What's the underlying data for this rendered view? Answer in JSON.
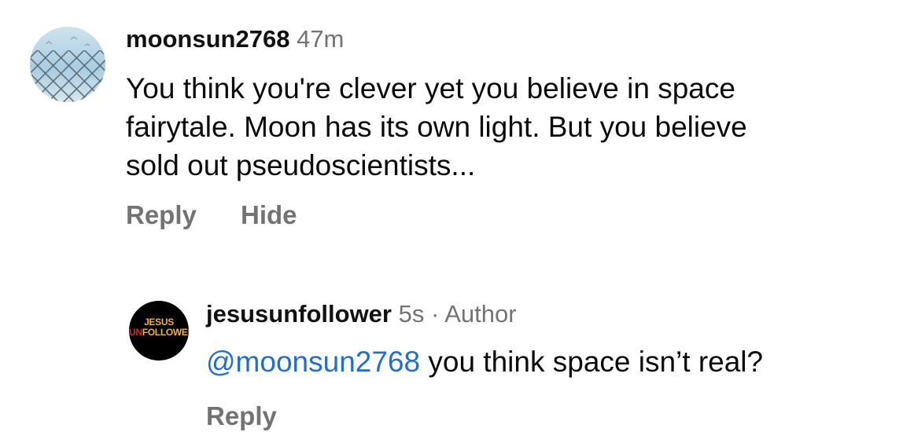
{
  "comment": {
    "username": "moonsun2768",
    "time": "47m",
    "text_lines": [
      "You think you're clever yet you believe in space",
      "fairytale. Moon has its own light. But you believe",
      "sold out pseudoscientists..."
    ],
    "actions": {
      "reply": "Reply",
      "hide": "Hide"
    },
    "avatar_icon": "chain-link-fence-sky-avatar"
  },
  "reply": {
    "username": "jesusunfollower",
    "time": "5s",
    "separator": "·",
    "author_label": "Author",
    "mention": "@moonsun2768",
    "text": " you think space isn’t real?",
    "actions": {
      "reply": "Reply"
    },
    "avatar": {
      "line1": "JESUS",
      "line2_prefix": "UN",
      "line2_rest": "FOLLOWER",
      "colors": {
        "bg": "#000000",
        "text": "#f2b233",
        "prefix": "#d9261c"
      }
    }
  },
  "colors": {
    "meta": "#737373",
    "mention": "#1f6fd1"
  }
}
